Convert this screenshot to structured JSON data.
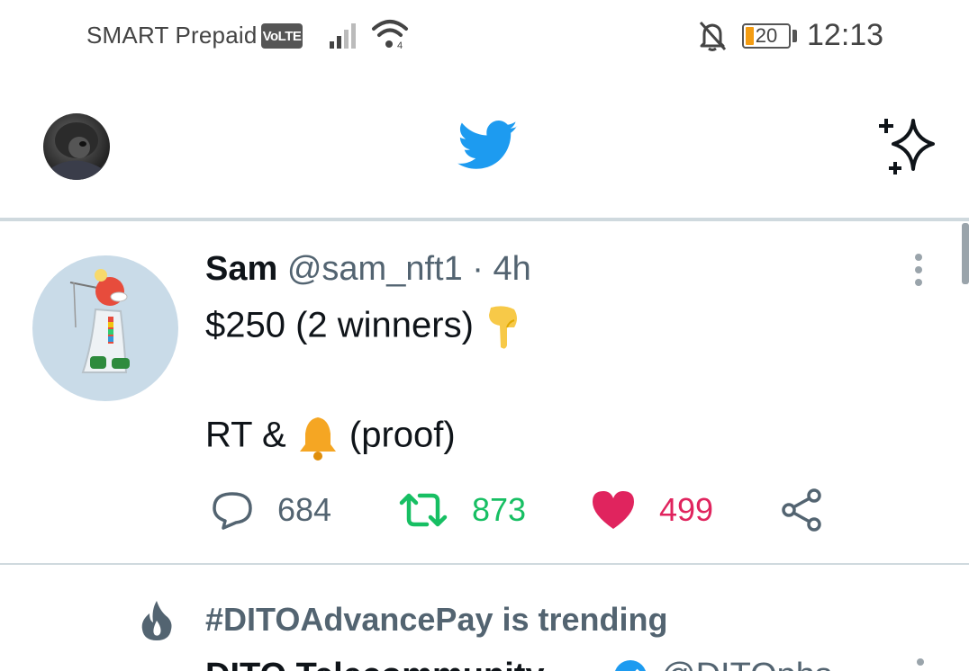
{
  "status_bar": {
    "carrier": "SMART Prepaid",
    "volte": "VoLTE",
    "battery": "20",
    "battery_level": 0.2,
    "time": "12:13"
  },
  "header": {
    "profile_icon": "avatar",
    "logo_icon": "twitter-bird-icon",
    "sparkle_icon": "sparkle-icon"
  },
  "tweet": {
    "display_name": "Sam",
    "handle": "@sam_nft1",
    "separator": "·",
    "time": "4h",
    "line1": "$250 (2 winners)",
    "line2_prefix": "RT &",
    "line2_suffix": "(proof)",
    "emoji1": "pointing-down-emoji",
    "emoji2": "bell-emoji",
    "replies": "684",
    "retweets": "873",
    "likes": "499"
  },
  "trending": {
    "text": "#DITOAdvancePay is trending",
    "next_name": "DITO Telecommunity",
    "next_handle": "@DITOphs"
  },
  "colors": {
    "twitter_blue": "#1d9bf0",
    "retweet_green": "#17bf63",
    "like_red": "#e0245e",
    "muted": "#536471"
  }
}
